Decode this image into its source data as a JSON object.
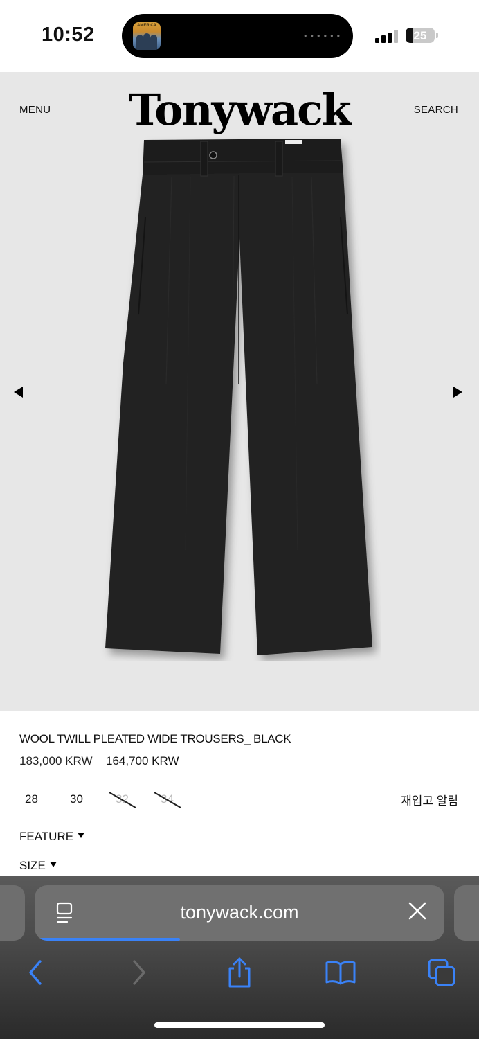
{
  "status_bar": {
    "time": "10:52",
    "battery": "25",
    "battery_level": 0.25,
    "now_playing_album_text": "AMERICA"
  },
  "header": {
    "menu_label": "MENU",
    "brand": "Tonywack",
    "search_label": "SEARCH"
  },
  "product": {
    "name": "WOOL TWILL PLEATED WIDE TROUSERS_ BLACK",
    "original_price": "183,000 KRW",
    "sale_price": "164,700 KRW",
    "sizes": [
      {
        "label": "28",
        "available": true
      },
      {
        "label": "30",
        "available": true
      },
      {
        "label": "32",
        "available": false
      },
      {
        "label": "34",
        "available": false
      }
    ],
    "restock_label": "재입고 알림",
    "feature_label": "FEATURE",
    "size_label": "SIZE",
    "image_icon": "black-wide-trousers-image"
  },
  "browser": {
    "url": "tonywack.com",
    "load_progress": 0.35,
    "accent_color": "#3a82f7",
    "icons": [
      "reader-icon",
      "close-icon",
      "back-icon",
      "forward-icon",
      "share-icon",
      "bookmarks-icon",
      "tabs-icon"
    ]
  }
}
